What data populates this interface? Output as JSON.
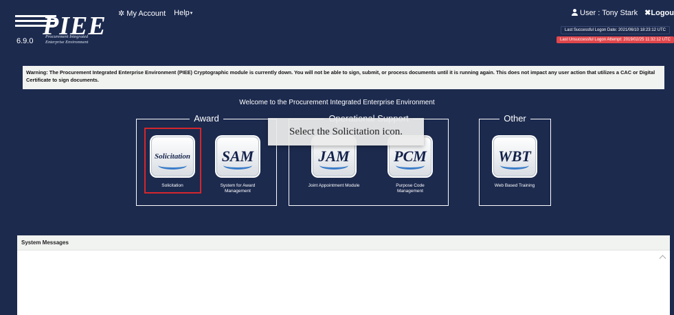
{
  "header": {
    "logo_text": "PIEE",
    "version": "6.9.0",
    "logo_subtitle_line1": "Procurement Integrated",
    "logo_subtitle_line2": "Enterprise Environment",
    "nav": {
      "my_account": "My Account",
      "help": "Help"
    },
    "user_label": "User : Tony Stark",
    "logout_label": "Logou",
    "last_successful_logon": "Last Successful Logon Date: 2021/06/10 18:23:12 UTC",
    "last_unsuccessful_logon": "Last Unsuccessful Logon Attempt: 2019/02/25 11:32:12 UTC"
  },
  "warning": "Warning: The Procurement Integrated Enterprise Environment (PIEE) Cryptographic module is currently down. You will not be able to sign, submit, or process documents until it is running again. This does not impact any user action that utilizes a CAC or Digital Certificate to sign documents.",
  "welcome": "Welcome to the Procurement Integrated Enterprise Environment",
  "groups": {
    "award": "Award",
    "operational": "Operational Support",
    "other": "Other"
  },
  "tiles": {
    "solicitation": {
      "icon_text": "Solicitation",
      "label": "Solicitation"
    },
    "sam": {
      "icon_text": "SAM",
      "label": "System for Award Management"
    },
    "jam": {
      "icon_text": "JAM",
      "label": "Joint Appointment Module"
    },
    "pcm": {
      "icon_text": "PCM",
      "label": "Purpose Code Management"
    },
    "wbt": {
      "icon_text": "WBT",
      "label": "Web Based Training"
    }
  },
  "tooltip": "Select the Solicitation icon.",
  "system_messages": {
    "title": "System Messages"
  },
  "colors": {
    "background": "#1c2a4e",
    "selection": "#d6262c",
    "alert": "#e0474c"
  }
}
